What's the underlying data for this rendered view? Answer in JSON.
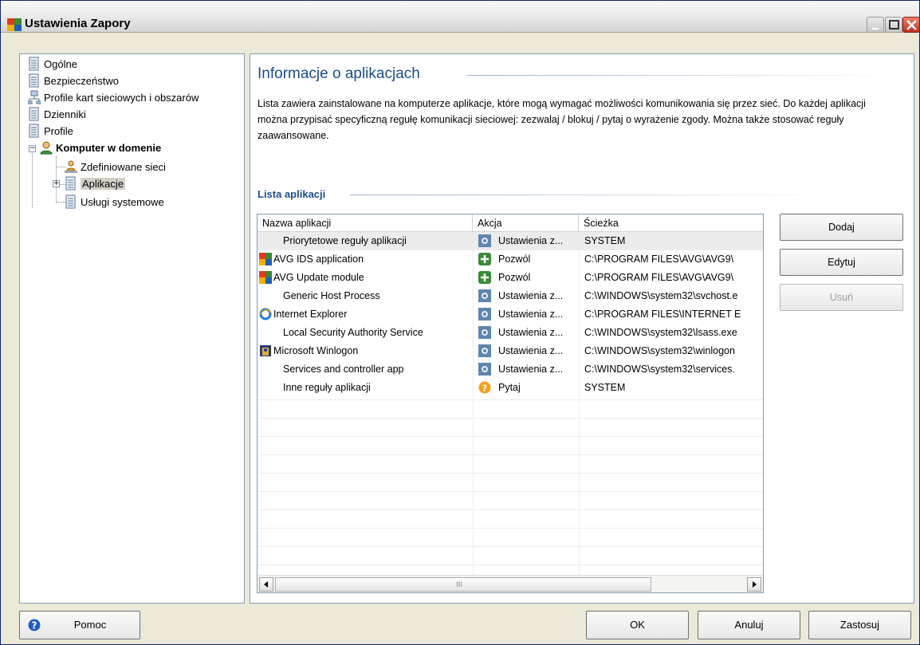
{
  "window": {
    "title": "Ustawienia Zapory"
  },
  "tree": {
    "items": [
      {
        "label": "Ogólne",
        "icon": "document-icon"
      },
      {
        "label": "Bezpieczeństwo",
        "icon": "document-icon"
      },
      {
        "label": "Profile kart sieciowych i obszarów",
        "icon": "network-icon"
      },
      {
        "label": "Dzienniki",
        "icon": "document-icon"
      },
      {
        "label": "Profile",
        "icon": "document-icon"
      },
      {
        "label": "Komputer w domenie",
        "icon": "user-icon"
      },
      {
        "label": "Zdefiniowane sieci",
        "icon": "user-network-icon"
      },
      {
        "label": "Aplikacje",
        "icon": "document-icon"
      },
      {
        "label": "Usługi systemowe",
        "icon": "document-icon"
      }
    ]
  },
  "main": {
    "title": "Informacje o aplikacjach",
    "description": "Lista zawiera zainstalowane na komputerze aplikacje, które mogą wymagać możliwości komunikowania się przez sieć. Do każdej aplikacji można przypisać specyficzną regułę komunikacji sieciowej: zezwalaj / blokuj / pytaj o wyrażenie zgody. Można także stosować reguły zaawansowane.",
    "section_title": "Lista aplikacji"
  },
  "list": {
    "columns": [
      "Nazwa aplikacji",
      "Akcja",
      "Ścieżka"
    ],
    "rows": [
      {
        "name": "Priorytetowe reguły aplikacji",
        "name_icon": "",
        "action": "Ustawienia z...",
        "action_icon": "gear-icon",
        "path": "SYSTEM"
      },
      {
        "name": "AVG IDS application",
        "name_icon": "avg-logo-icon",
        "action": "Pozwól",
        "action_icon": "allow-icon",
        "path": "C:\\PROGRAM FILES\\AVG\\AVG9\\"
      },
      {
        "name": "AVG Update module",
        "name_icon": "avg-logo-icon",
        "action": "Pozwól",
        "action_icon": "allow-icon",
        "path": "C:\\PROGRAM FILES\\AVG\\AVG9\\"
      },
      {
        "name": "Generic Host Process",
        "name_icon": "",
        "action": "Ustawienia z...",
        "action_icon": "gear-icon",
        "path": "C:\\WINDOWS\\system32\\svchost.e"
      },
      {
        "name": "Internet Explorer",
        "name_icon": "ie-icon",
        "action": "Ustawienia z...",
        "action_icon": "gear-icon",
        "path": "C:\\PROGRAM FILES\\INTERNET E"
      },
      {
        "name": "Local Security Authority Service",
        "name_icon": "",
        "action": "Ustawienia z...",
        "action_icon": "gear-icon",
        "path": "C:\\WINDOWS\\system32\\lsass.exe"
      },
      {
        "name": "Microsoft Winlogon",
        "name_icon": "winlogon-icon",
        "action": "Ustawienia z...",
        "action_icon": "gear-icon",
        "path": "C:\\WINDOWS\\system32\\winlogon"
      },
      {
        "name": "Services and controller app",
        "name_icon": "",
        "action": "Ustawienia z...",
        "action_icon": "gear-icon",
        "path": "C:\\WINDOWS\\system32\\services."
      },
      {
        "name": "Inne reguły aplikacji",
        "name_icon": "",
        "action": "Pytaj",
        "action_icon": "ask-icon",
        "path": "SYSTEM"
      }
    ],
    "scroll_grip": "III"
  },
  "side_buttons": {
    "add": "Dodaj",
    "edit": "Edytuj",
    "remove": "Usuń"
  },
  "footer": {
    "help": "Pomoc",
    "ok": "OK",
    "cancel": "Anuluj",
    "apply": "Zastosuj"
  },
  "colors": {
    "accent_title": "#1a4d8f",
    "border": "#7f9db9",
    "window_bg": "#ece9d8"
  }
}
